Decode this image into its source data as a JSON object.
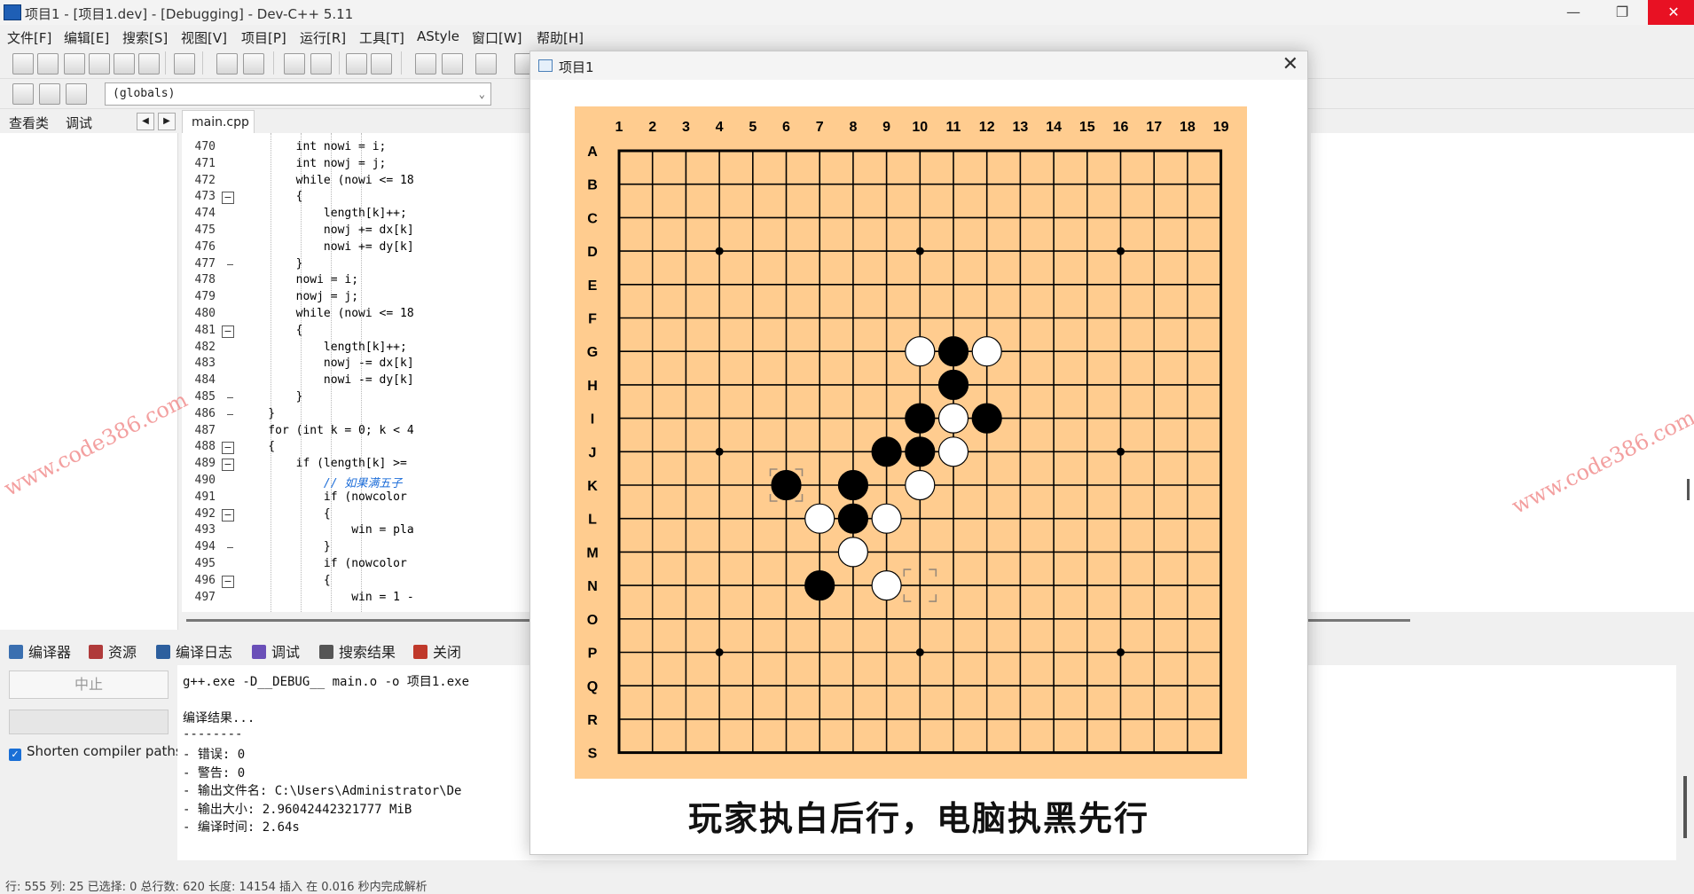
{
  "window": {
    "title": "项目1 - [项目1.dev] - [Debugging] - Dev-C++ 5.11",
    "minimize": "—",
    "maximize": "❐",
    "close": "✕"
  },
  "menu": [
    "文件[F]",
    "编辑[E]",
    "搜索[S]",
    "视图[V]",
    "项目[P]",
    "运行[R]",
    "工具[T]",
    "AStyle",
    "窗口[W]",
    "帮助[H]"
  ],
  "toolbar2": {
    "scope_combo": "(globals)"
  },
  "left_tabs": {
    "classes": "查看类",
    "debug": "调试"
  },
  "editor": {
    "tab": "main.cpp",
    "lines": [
      {
        "n": "470",
        "fold": "",
        "code": "        int nowi = i;",
        "cls": ""
      },
      {
        "n": "471",
        "fold": "",
        "code": "        int nowj = j;",
        "cls": ""
      },
      {
        "n": "472",
        "fold": "",
        "code": "        while (nowi <= 18",
        "cls": ""
      },
      {
        "n": "473",
        "fold": "box",
        "code": "        {",
        "cls": ""
      },
      {
        "n": "474",
        "fold": "",
        "code": "            length[k]++;",
        "cls": ""
      },
      {
        "n": "475",
        "fold": "",
        "code": "            nowj += dx[k]",
        "cls": ""
      },
      {
        "n": "476",
        "fold": "",
        "code": "            nowi += dy[k]",
        "cls": ""
      },
      {
        "n": "477",
        "fold": "end",
        "code": "        }",
        "cls": ""
      },
      {
        "n": "478",
        "fold": "",
        "code": "        nowi = i;",
        "cls": ""
      },
      {
        "n": "479",
        "fold": "",
        "code": "        nowj = j;",
        "cls": ""
      },
      {
        "n": "480",
        "fold": "",
        "code": "        while (nowi <= 18",
        "cls": ""
      },
      {
        "n": "481",
        "fold": "box",
        "code": "        {",
        "cls": ""
      },
      {
        "n": "482",
        "fold": "",
        "code": "            length[k]++;",
        "cls": ""
      },
      {
        "n": "483",
        "fold": "",
        "code": "            nowj -= dx[k]",
        "cls": ""
      },
      {
        "n": "484",
        "fold": "",
        "code": "            nowi -= dy[k]",
        "cls": ""
      },
      {
        "n": "485",
        "fold": "end",
        "code": "        }",
        "cls": ""
      },
      {
        "n": "486",
        "fold": "end",
        "code": "    }",
        "cls": ""
      },
      {
        "n": "487",
        "fold": "",
        "code": "    for (int k = 0; k < 4",
        "cls": ""
      },
      {
        "n": "488",
        "fold": "box",
        "code": "    {",
        "cls": ""
      },
      {
        "n": "489",
        "fold": "box",
        "code": "        if (length[k] >= ",
        "cls": ""
      },
      {
        "n": "490",
        "fold": "",
        "code": "            // 如果满五子",
        "cls": "cm"
      },
      {
        "n": "491",
        "fold": "",
        "code": "            if (nowcolor ",
        "cls": ""
      },
      {
        "n": "492",
        "fold": "box",
        "code": "            {",
        "cls": ""
      },
      {
        "n": "493",
        "fold": "",
        "code": "                win = pla",
        "cls": ""
      },
      {
        "n": "494",
        "fold": "end",
        "code": "            }",
        "cls": ""
      },
      {
        "n": "495",
        "fold": "",
        "code": "            if (nowcolor ",
        "cls": ""
      },
      {
        "n": "496",
        "fold": "box",
        "code": "            {",
        "cls": ""
      },
      {
        "n": "497",
        "fold": "",
        "code": "                win = 1 -",
        "cls": ""
      }
    ]
  },
  "bottom_tabs": [
    "编译器",
    "资源",
    "编译日志",
    "调试",
    "搜索结果",
    "关闭"
  ],
  "compile": {
    "stop_label": "中止",
    "shorten_label": "Shorten compiler paths",
    "log": [
      "g++.exe -D__DEBUG__ main.o -o 项目1.exe",
      "",
      "编译结果...",
      "--------",
      "- 错误: 0",
      "- 警告: 0",
      "- 输出文件名: C:\\Users\\Administrator\\De",
      "- 输出大小: 2.96042442321777 MiB",
      "- 编译时间: 2.64s"
    ]
  },
  "status": {
    "text": "行: 555    列: 25    已选择: 0    总行数: 620    长度: 14154    插入    在 0.016 秒内完成解析"
  },
  "watermark": "www.code386.com",
  "dialog": {
    "title": "项目1",
    "close": "✕",
    "caption": "玩家执白后行，电脑执黑先行",
    "board": {
      "cols": [
        "1",
        "2",
        "3",
        "4",
        "5",
        "6",
        "7",
        "8",
        "9",
        "10",
        "11",
        "12",
        "13",
        "14",
        "15",
        "16",
        "17",
        "18",
        "19"
      ],
      "rows": [
        "A",
        "B",
        "C",
        "D",
        "E",
        "F",
        "G",
        "H",
        "I",
        "J",
        "K",
        "L",
        "M",
        "N",
        "O",
        "P",
        "Q",
        "R",
        "S"
      ],
      "board_color": "#ffcc8f",
      "stones": [
        {
          "row": "G",
          "col": 10,
          "color": "white"
        },
        {
          "row": "G",
          "col": 11,
          "color": "black"
        },
        {
          "row": "G",
          "col": 12,
          "color": "white"
        },
        {
          "row": "H",
          "col": 11,
          "color": "black"
        },
        {
          "row": "I",
          "col": 10,
          "color": "black"
        },
        {
          "row": "I",
          "col": 11,
          "color": "white"
        },
        {
          "row": "I",
          "col": 12,
          "color": "black"
        },
        {
          "row": "J",
          "col": 9,
          "color": "black"
        },
        {
          "row": "J",
          "col": 10,
          "color": "black"
        },
        {
          "row": "J",
          "col": 11,
          "color": "white"
        },
        {
          "row": "K",
          "col": 6,
          "color": "black"
        },
        {
          "row": "K",
          "col": 8,
          "color": "black"
        },
        {
          "row": "K",
          "col": 10,
          "color": "white"
        },
        {
          "row": "L",
          "col": 7,
          "color": "white"
        },
        {
          "row": "L",
          "col": 8,
          "color": "black"
        },
        {
          "row": "L",
          "col": 9,
          "color": "white"
        },
        {
          "row": "M",
          "col": 8,
          "color": "white"
        },
        {
          "row": "N",
          "col": 7,
          "color": "black"
        },
        {
          "row": "N",
          "col": 9,
          "color": "white"
        }
      ],
      "star_points": [
        [
          "D",
          4
        ],
        [
          "D",
          10
        ],
        [
          "D",
          16
        ],
        [
          "J",
          4
        ],
        [
          "J",
          16
        ],
        [
          "P",
          4
        ],
        [
          "P",
          10
        ],
        [
          "P",
          16
        ]
      ],
      "cursor": {
        "row": "N",
        "col": 10
      },
      "last_move": {
        "row": "K",
        "col": 6
      }
    }
  }
}
